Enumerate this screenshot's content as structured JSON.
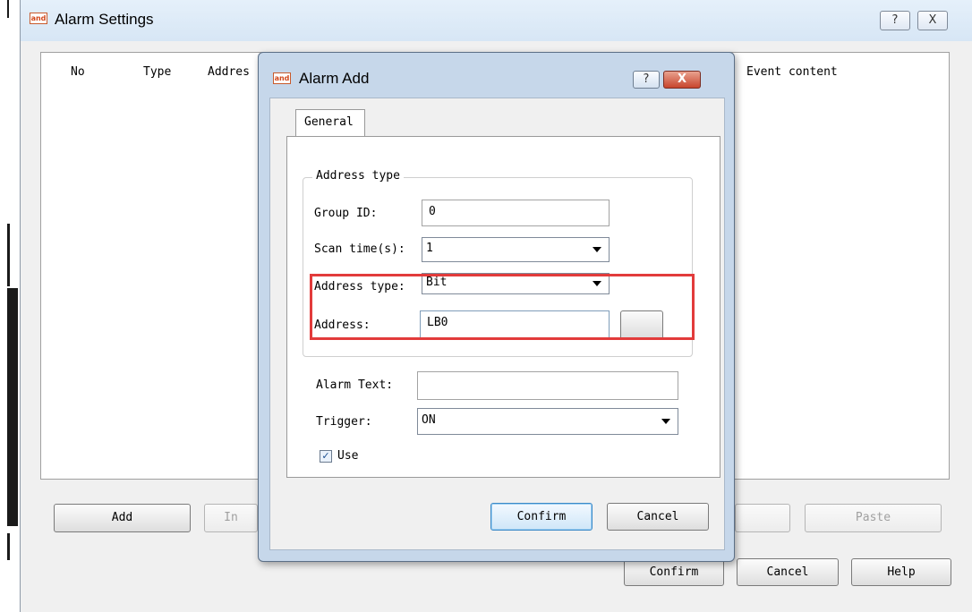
{
  "main_window": {
    "title": "Alarm Settings",
    "help_glyph": "?",
    "close_glyph": "X",
    "logo_text": "and"
  },
  "alarm_list": {
    "columns": [
      "No",
      "Type",
      "Addres",
      "Event content"
    ]
  },
  "main_buttons": {
    "add": "Add",
    "insert_partial": "In",
    "paste": "Paste",
    "confirm": "Confirm",
    "cancel": "Cancel",
    "help": "Help"
  },
  "dialog": {
    "title": "Alarm Add",
    "help_glyph": "?",
    "close_glyph": "X",
    "tab_general": "General",
    "group_title": "Address type",
    "group_id_label": "Group ID:",
    "group_id_value": "0",
    "scan_time_label": "Scan time(s):",
    "scan_time_value": "1",
    "address_type_label": "Address type:",
    "address_type_value": "Bit",
    "address_label": "Address:",
    "address_value": "LB0",
    "alarm_text_label": "Alarm Text:",
    "alarm_text_value": "",
    "trigger_label": "Trigger:",
    "trigger_value": "ON",
    "use_label": "Use",
    "use_checked": "✓",
    "confirm": "Confirm",
    "cancel": "Cancel"
  },
  "colors": {
    "highlight": "#e23b3b",
    "dialog_frame": "#c6d7ea"
  }
}
